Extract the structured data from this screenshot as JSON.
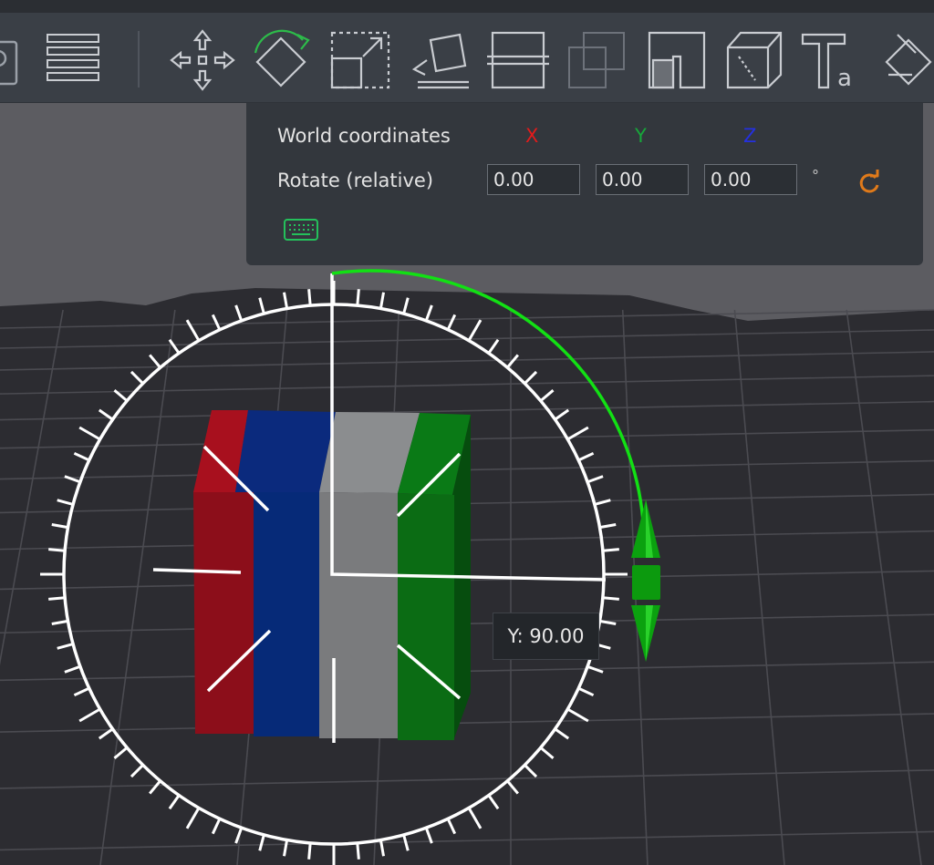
{
  "toolbar": {
    "tools": [
      {
        "name": "move-tool-icon"
      },
      {
        "name": "rotate-tool-icon"
      },
      {
        "name": "scale-tool-icon"
      },
      {
        "name": "lay-on-face-icon"
      },
      {
        "name": "cut-tool-icon"
      },
      {
        "name": "split-parts-icon"
      },
      {
        "name": "support-paint-icon"
      },
      {
        "name": "seam-paint-icon"
      },
      {
        "name": "text-tool-icon"
      },
      {
        "name": "color-paint-icon"
      }
    ]
  },
  "panel": {
    "coord_label": "World coordinates",
    "axis_x": "X",
    "axis_y": "Y",
    "axis_z": "Z",
    "rotate_label": "Rotate (relative)",
    "x_value": "0.00",
    "y_value": "0.00",
    "z_value": "0.00",
    "unit": "°",
    "colors": {
      "x": "#e21b1b",
      "y": "#17a83a",
      "z": "#2430e0",
      "reset": "#e07a1a"
    }
  },
  "tooltip": {
    "text": "Y: 90.00"
  }
}
